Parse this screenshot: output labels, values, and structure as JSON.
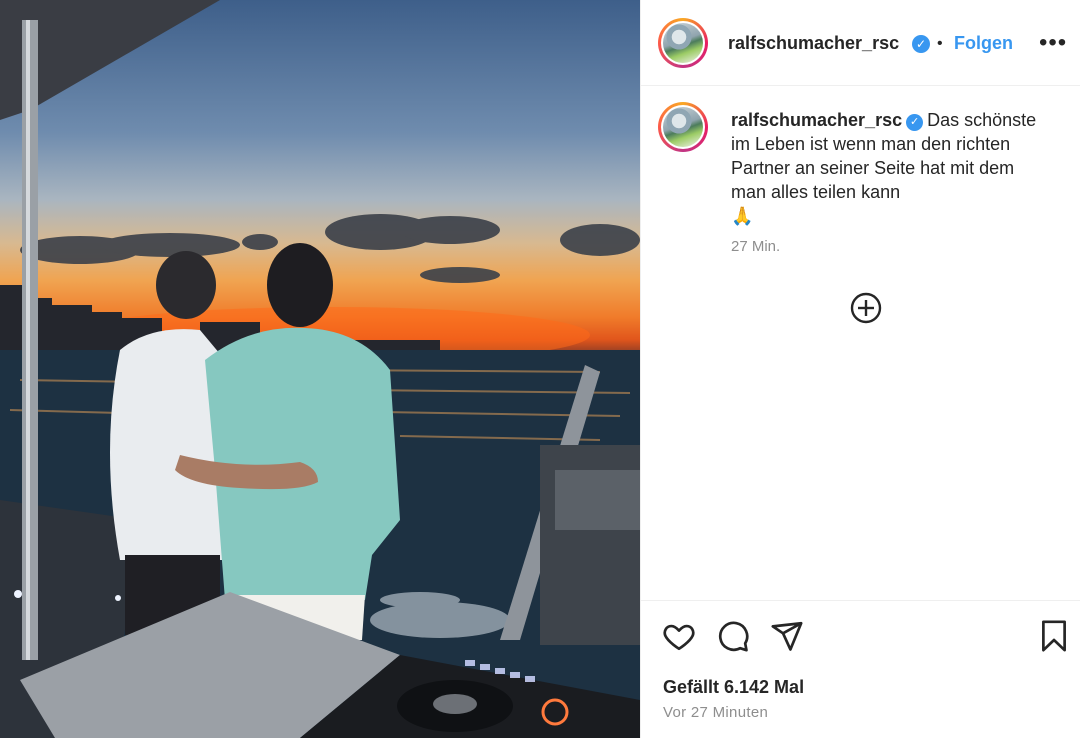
{
  "post": {
    "username": "ralfschumacher_rsc",
    "verified_mark": "✓",
    "separator": "•",
    "follow_label": "Folgen",
    "more_label": "•••",
    "caption_user": "ralfschumacher_rsc",
    "caption_text": "Das schönste im Leben ist wenn man den richten Partner an seiner Seite hat mit dem man alles teilen kann",
    "caption_emoji": "🙏",
    "caption_time": "27 Min.",
    "likes_text": "Gefällt 6.142 Mal",
    "posted_ago": "Vor 27 Minuten"
  },
  "icons": {
    "like": "heart-icon",
    "comment": "comment-icon",
    "share": "paper-plane-icon",
    "save": "bookmark-icon",
    "load_more": "plus-circle-icon",
    "more": "more-options-icon"
  },
  "colors": {
    "accent": "#3897f0",
    "text": "#262626",
    "muted": "#8e8e8e",
    "border": "#efefef"
  }
}
